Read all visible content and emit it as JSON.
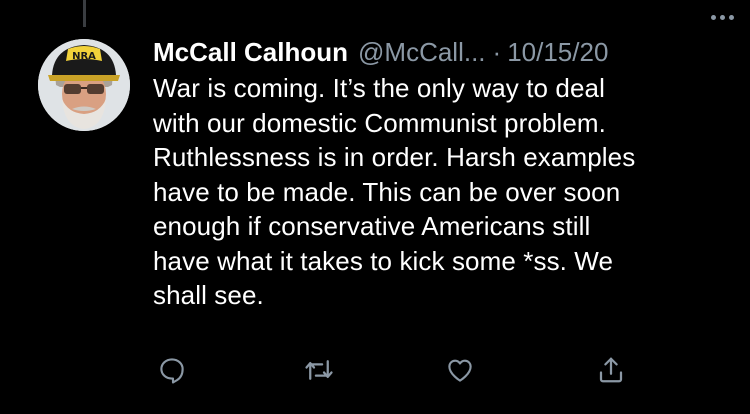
{
  "tweet": {
    "display_name": "McCall Calhoun",
    "handle": "@McCall...",
    "separator": "·",
    "date": "10/15/20",
    "avatar_cap_text": "NRA",
    "text": "War is coming. It’s the only way to deal\nwith our domestic Communist problem.\nRuthlessness is in order. Harsh examples\nhave to be made. This can be over soon\nenough if conservative Americans still\nhave what it takes to kick some *ss. We\nshall see."
  },
  "actions": [
    {
      "name": "reply",
      "icon": "reply-icon"
    },
    {
      "name": "retweet",
      "icon": "retweet-icon"
    },
    {
      "name": "like",
      "icon": "heart-icon"
    },
    {
      "name": "share",
      "icon": "share-icon"
    }
  ],
  "colors": {
    "background": "#000000",
    "primary_text": "#ffffff",
    "secondary_text": "#8b98a5",
    "thread_line": "#3a3d41"
  }
}
